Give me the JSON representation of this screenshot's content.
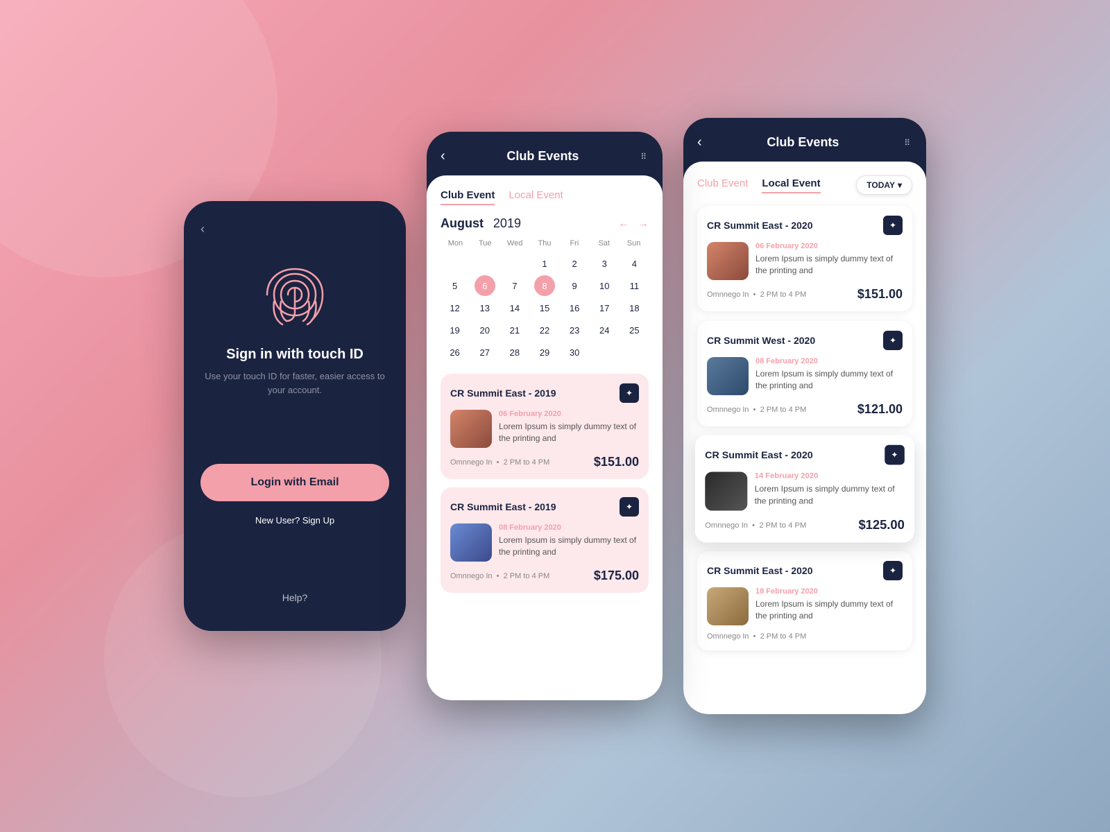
{
  "background": {
    "gradient_from": "#f7a8b8",
    "gradient_to": "#8fa8c0"
  },
  "screen_login": {
    "back_label": "‹",
    "title": "Sign in with touch ID",
    "subtitle": "Use your touch ID for faster, easier\naccess to your account.",
    "login_button_label": "Login with Email",
    "signup_label": "New User? Sign Up",
    "help_label": "Help?"
  },
  "screen_calendar": {
    "header": {
      "back_label": "‹",
      "title": "Club Events",
      "dots_label": "⋮⋮"
    },
    "tabs": [
      {
        "label": "Club Event",
        "active": true
      },
      {
        "label": "Local Event",
        "active": false
      }
    ],
    "calendar": {
      "month": "August",
      "year": "2019",
      "day_names": [
        "Mon",
        "Tue",
        "Wed",
        "Thu",
        "Fri",
        "Sat",
        "Sun"
      ],
      "dates": [
        {
          "val": "",
          "empty": true
        },
        {
          "val": "",
          "empty": true
        },
        {
          "val": "",
          "empty": true
        },
        {
          "val": "1",
          "empty": false
        },
        {
          "val": "2",
          "empty": false
        },
        {
          "val": "3",
          "empty": false
        },
        {
          "val": "4",
          "empty": false
        },
        {
          "val": "5",
          "empty": false
        },
        {
          "val": "6",
          "empty": false,
          "highlighted": true
        },
        {
          "val": "7",
          "empty": false
        },
        {
          "val": "8",
          "empty": false,
          "highlighted": true
        },
        {
          "val": "9",
          "empty": false
        },
        {
          "val": "10",
          "empty": false
        },
        {
          "val": "11",
          "empty": false
        },
        {
          "val": "12",
          "empty": false
        },
        {
          "val": "13",
          "empty": false
        },
        {
          "val": "14",
          "empty": false
        },
        {
          "val": "15",
          "empty": false
        },
        {
          "val": "16",
          "empty": false
        },
        {
          "val": "17",
          "empty": false
        },
        {
          "val": "18",
          "empty": false
        },
        {
          "val": "19",
          "empty": false
        },
        {
          "val": "20",
          "empty": false
        },
        {
          "val": "21",
          "empty": false
        },
        {
          "val": "22",
          "empty": false
        },
        {
          "val": "23",
          "empty": false
        },
        {
          "val": "24",
          "empty": false
        },
        {
          "val": "25",
          "empty": false
        },
        {
          "val": "26",
          "empty": false
        },
        {
          "val": "27",
          "empty": false
        },
        {
          "val": "28",
          "empty": false
        },
        {
          "val": "29",
          "empty": false
        },
        {
          "val": "30",
          "empty": false
        }
      ]
    },
    "events": [
      {
        "title": "CR Summit East - 2019",
        "date": "06 February 2020",
        "desc": "Lorem Ipsum is simply dummy text of the printing and",
        "location": "Omnnego In",
        "time": "2 PM to 4 PM",
        "price": "$151.00"
      },
      {
        "title": "CR Summit East - 2019",
        "date": "08 February 2020",
        "desc": "Lorem Ipsum is simply dummy text of the printing and",
        "location": "Omnnego In",
        "time": "2 PM to 4 PM",
        "price": "$175.00"
      }
    ]
  },
  "screen_events": {
    "header": {
      "back_label": "‹",
      "title": "Club Events",
      "dots_label": "⋮⋮"
    },
    "tabs": [
      {
        "label": "Club Event",
        "active": false
      },
      {
        "label": "Local Event",
        "active": true
      }
    ],
    "today_button_label": "TODAY",
    "events": [
      {
        "title": "CR Summit East - 2020",
        "date": "06 February 2020",
        "desc": "Lorem Ipsum is simply dummy text of the printing and",
        "location": "Omnnego In",
        "time": "2 PM to 4 PM",
        "price": "$151.00",
        "elevated": false
      },
      {
        "title": "CR Summit West - 2020",
        "date": "08 February 2020",
        "desc": "Lorem Ipsum is simply dummy text of the printing and",
        "location": "Omnnego In",
        "time": "2 PM to 4 PM",
        "price": "$121.00",
        "elevated": false
      },
      {
        "title": "CR Summit East - 2020",
        "date": "14 February 2020",
        "desc": "Lorem Ipsum is simply dummy text of the printing and",
        "location": "Omnnego In",
        "time": "2 PM to 4 PM",
        "price": "$125.00",
        "elevated": true
      },
      {
        "title": "CR Summit East - 2020",
        "date": "18 February 2020",
        "desc": "Lorem Ipsum is simply dummy text of the printing and",
        "location": "Omnnego In",
        "time": "2 PM to 4 PM",
        "price": "",
        "elevated": false
      }
    ]
  }
}
